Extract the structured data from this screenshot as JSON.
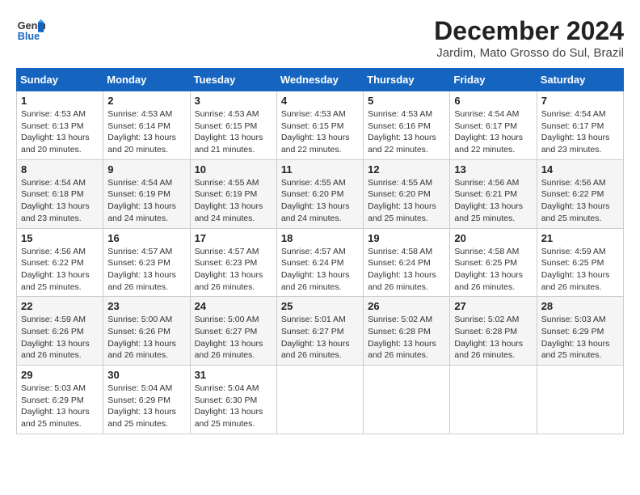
{
  "header": {
    "logo_line1": "General",
    "logo_line2": "Blue",
    "month": "December 2024",
    "location": "Jardim, Mato Grosso do Sul, Brazil"
  },
  "days_of_week": [
    "Sunday",
    "Monday",
    "Tuesday",
    "Wednesday",
    "Thursday",
    "Friday",
    "Saturday"
  ],
  "weeks": [
    [
      {
        "day": "1",
        "sunrise": "4:53 AM",
        "sunset": "6:13 PM",
        "daylight": "13 hours and 20 minutes."
      },
      {
        "day": "2",
        "sunrise": "4:53 AM",
        "sunset": "6:14 PM",
        "daylight": "13 hours and 20 minutes."
      },
      {
        "day": "3",
        "sunrise": "4:53 AM",
        "sunset": "6:15 PM",
        "daylight": "13 hours and 21 minutes."
      },
      {
        "day": "4",
        "sunrise": "4:53 AM",
        "sunset": "6:15 PM",
        "daylight": "13 hours and 22 minutes."
      },
      {
        "day": "5",
        "sunrise": "4:53 AM",
        "sunset": "6:16 PM",
        "daylight": "13 hours and 22 minutes."
      },
      {
        "day": "6",
        "sunrise": "4:54 AM",
        "sunset": "6:17 PM",
        "daylight": "13 hours and 22 minutes."
      },
      {
        "day": "7",
        "sunrise": "4:54 AM",
        "sunset": "6:17 PM",
        "daylight": "13 hours and 23 minutes."
      }
    ],
    [
      {
        "day": "8",
        "sunrise": "4:54 AM",
        "sunset": "6:18 PM",
        "daylight": "13 hours and 23 minutes."
      },
      {
        "day": "9",
        "sunrise": "4:54 AM",
        "sunset": "6:19 PM",
        "daylight": "13 hours and 24 minutes."
      },
      {
        "day": "10",
        "sunrise": "4:55 AM",
        "sunset": "6:19 PM",
        "daylight": "13 hours and 24 minutes."
      },
      {
        "day": "11",
        "sunrise": "4:55 AM",
        "sunset": "6:20 PM",
        "daylight": "13 hours and 24 minutes."
      },
      {
        "day": "12",
        "sunrise": "4:55 AM",
        "sunset": "6:20 PM",
        "daylight": "13 hours and 25 minutes."
      },
      {
        "day": "13",
        "sunrise": "4:56 AM",
        "sunset": "6:21 PM",
        "daylight": "13 hours and 25 minutes."
      },
      {
        "day": "14",
        "sunrise": "4:56 AM",
        "sunset": "6:22 PM",
        "daylight": "13 hours and 25 minutes."
      }
    ],
    [
      {
        "day": "15",
        "sunrise": "4:56 AM",
        "sunset": "6:22 PM",
        "daylight": "13 hours and 25 minutes."
      },
      {
        "day": "16",
        "sunrise": "4:57 AM",
        "sunset": "6:23 PM",
        "daylight": "13 hours and 26 minutes."
      },
      {
        "day": "17",
        "sunrise": "4:57 AM",
        "sunset": "6:23 PM",
        "daylight": "13 hours and 26 minutes."
      },
      {
        "day": "18",
        "sunrise": "4:57 AM",
        "sunset": "6:24 PM",
        "daylight": "13 hours and 26 minutes."
      },
      {
        "day": "19",
        "sunrise": "4:58 AM",
        "sunset": "6:24 PM",
        "daylight": "13 hours and 26 minutes."
      },
      {
        "day": "20",
        "sunrise": "4:58 AM",
        "sunset": "6:25 PM",
        "daylight": "13 hours and 26 minutes."
      },
      {
        "day": "21",
        "sunrise": "4:59 AM",
        "sunset": "6:25 PM",
        "daylight": "13 hours and 26 minutes."
      }
    ],
    [
      {
        "day": "22",
        "sunrise": "4:59 AM",
        "sunset": "6:26 PM",
        "daylight": "13 hours and 26 minutes."
      },
      {
        "day": "23",
        "sunrise": "5:00 AM",
        "sunset": "6:26 PM",
        "daylight": "13 hours and 26 minutes."
      },
      {
        "day": "24",
        "sunrise": "5:00 AM",
        "sunset": "6:27 PM",
        "daylight": "13 hours and 26 minutes."
      },
      {
        "day": "25",
        "sunrise": "5:01 AM",
        "sunset": "6:27 PM",
        "daylight": "13 hours and 26 minutes."
      },
      {
        "day": "26",
        "sunrise": "5:02 AM",
        "sunset": "6:28 PM",
        "daylight": "13 hours and 26 minutes."
      },
      {
        "day": "27",
        "sunrise": "5:02 AM",
        "sunset": "6:28 PM",
        "daylight": "13 hours and 26 minutes."
      },
      {
        "day": "28",
        "sunrise": "5:03 AM",
        "sunset": "6:29 PM",
        "daylight": "13 hours and 25 minutes."
      }
    ],
    [
      {
        "day": "29",
        "sunrise": "5:03 AM",
        "sunset": "6:29 PM",
        "daylight": "13 hours and 25 minutes."
      },
      {
        "day": "30",
        "sunrise": "5:04 AM",
        "sunset": "6:29 PM",
        "daylight": "13 hours and 25 minutes."
      },
      {
        "day": "31",
        "sunrise": "5:04 AM",
        "sunset": "6:30 PM",
        "daylight": "13 hours and 25 minutes."
      },
      null,
      null,
      null,
      null
    ]
  ]
}
